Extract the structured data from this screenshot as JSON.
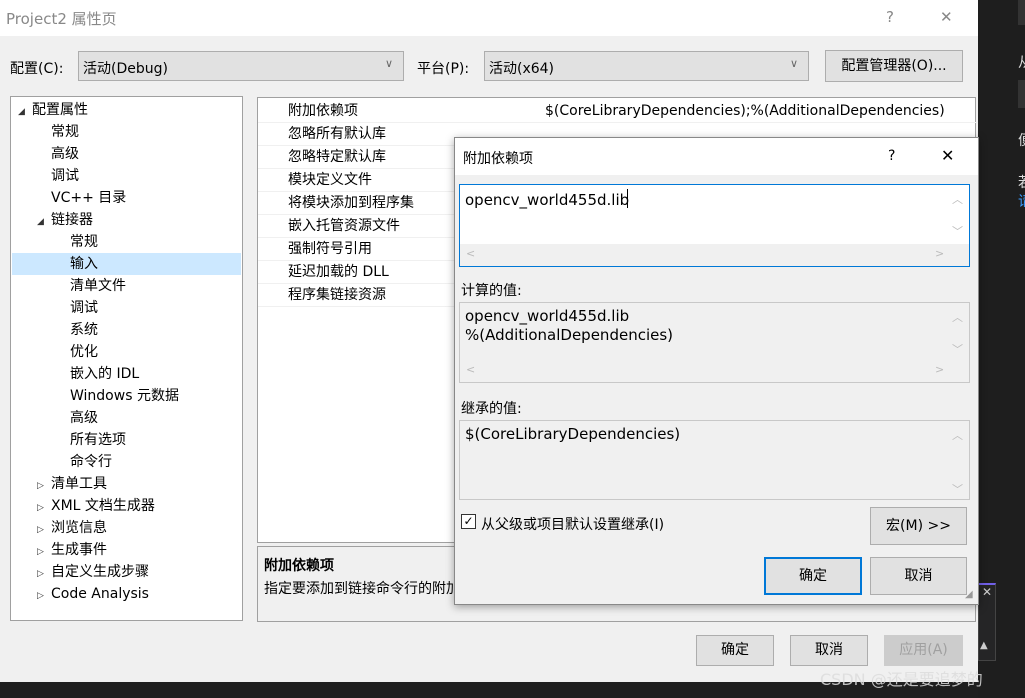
{
  "window": {
    "title": "Project2 属性页",
    "help": "?",
    "close": "✕"
  },
  "config": {
    "config_label": "配置(C):",
    "config_value": "活动(Debug)",
    "platform_label": "平台(P):",
    "platform_value": "活动(x64)",
    "manager_button": "配置管理器(O)..."
  },
  "tree": [
    {
      "label": "配置属性",
      "expand": "◢",
      "level": 0
    },
    {
      "label": "常规",
      "level": 1
    },
    {
      "label": "高级",
      "level": 1
    },
    {
      "label": "调试",
      "level": 1
    },
    {
      "label": "VC++ 目录",
      "level": 1
    },
    {
      "label": "链接器",
      "expand": "◢",
      "level": 1
    },
    {
      "label": "常规",
      "level": 2
    },
    {
      "label": "输入",
      "level": 2,
      "selected": true
    },
    {
      "label": "清单文件",
      "level": 2
    },
    {
      "label": "调试",
      "level": 2
    },
    {
      "label": "系统",
      "level": 2
    },
    {
      "label": "优化",
      "level": 2
    },
    {
      "label": "嵌入的 IDL",
      "level": 2
    },
    {
      "label": "Windows 元数据",
      "level": 2
    },
    {
      "label": "高级",
      "level": 2
    },
    {
      "label": "所有选项",
      "level": 2
    },
    {
      "label": "命令行",
      "level": 2
    },
    {
      "label": "清单工具",
      "expand": "▷",
      "level": 1
    },
    {
      "label": "XML 文档生成器",
      "expand": "▷",
      "level": 1
    },
    {
      "label": "浏览信息",
      "expand": "▷",
      "level": 1
    },
    {
      "label": "生成事件",
      "expand": "▷",
      "level": 1
    },
    {
      "label": "自定义生成步骤",
      "expand": "▷",
      "level": 1
    },
    {
      "label": "Code Analysis",
      "expand": "▷",
      "level": 1
    }
  ],
  "grid": [
    {
      "name": "附加依赖项",
      "value": "$(CoreLibraryDependencies);%(AdditionalDependencies)"
    },
    {
      "name": "忽略所有默认库",
      "value": ""
    },
    {
      "name": "忽略特定默认库",
      "value": ""
    },
    {
      "name": "模块定义文件",
      "value": ""
    },
    {
      "name": "将模块添加到程序集",
      "value": ""
    },
    {
      "name": "嵌入托管资源文件",
      "value": ""
    },
    {
      "name": "强制符号引用",
      "value": ""
    },
    {
      "name": "延迟加载的 DLL",
      "value": ""
    },
    {
      "name": "程序集链接资源",
      "value": ""
    }
  ],
  "description": {
    "title": "附加依赖项",
    "text": "指定要添加到链接命令行的附加项"
  },
  "buttons": {
    "ok": "确定",
    "cancel": "取消",
    "apply": "应用(A)"
  },
  "dialog": {
    "title": "附加依赖项",
    "help": "?",
    "close": "✕",
    "edit_value": "opencv_world455d.lib",
    "computed_label": "计算的值:",
    "computed_lines": [
      "opencv_world455d.lib",
      "%(AdditionalDependencies)"
    ],
    "inherited_label": "继承的值:",
    "inherited_value": "$(CoreLibraryDependencies)",
    "inherit_checkbox": "从父级或项目默认设置继承(I)",
    "inherit_checked": true,
    "macros_button": "宏(M) >>",
    "ok": "确定",
    "cancel": "取消"
  },
  "side": {
    "t1": "从",
    "t2": "便",
    "t3": "若",
    "t4": "请"
  },
  "watermark": "CSDN @还是要追梦的",
  "colors": {
    "accent": "#0078d7",
    "selected": "#cce8ff",
    "dark": "#1f1f1f"
  }
}
